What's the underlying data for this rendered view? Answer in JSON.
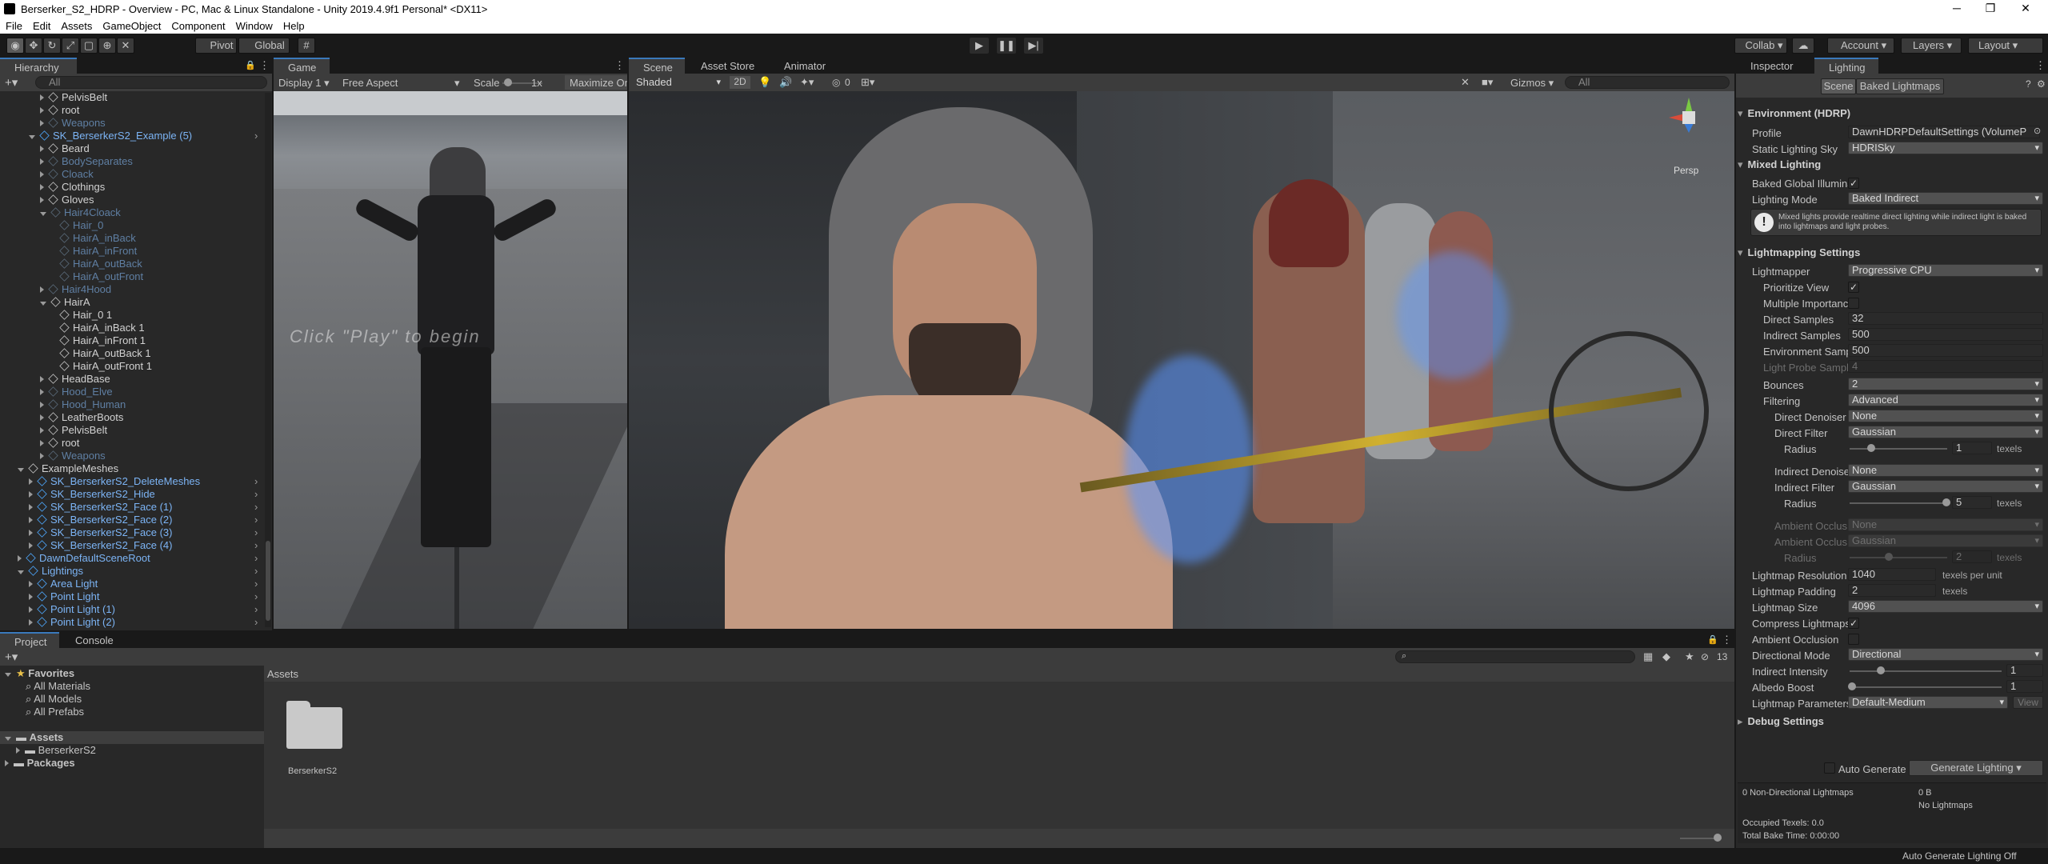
{
  "window": {
    "title": "Berserker_S2_HDRP - Overview - PC, Mac & Linux Standalone - Unity 2019.4.9f1 Personal* <DX11>"
  },
  "menu": [
    "File",
    "Edit",
    "Assets",
    "GameObject",
    "Component",
    "Window",
    "Help"
  ],
  "toolbar": {
    "pivot": "Pivot",
    "global": "Global",
    "collab": "Collab",
    "account": "Account",
    "layers": "Layers",
    "layout": "Layout"
  },
  "hierarchy": {
    "tab": "Hierarchy",
    "search_placeholder": "All",
    "items": [
      {
        "label": "PelvisBelt",
        "style": "white",
        "indent": 3
      },
      {
        "label": "root",
        "style": "white",
        "indent": 3
      },
      {
        "label": "Weapons",
        "style": "dim",
        "indent": 3
      },
      {
        "label": "SK_BerserkerS2_Example (5)",
        "style": "blue",
        "indent": 2,
        "expanded": true
      },
      {
        "label": "Beard",
        "style": "white",
        "indent": 3
      },
      {
        "label": "BodySeparates",
        "style": "dim",
        "indent": 3
      },
      {
        "label": "Cloack",
        "style": "dim",
        "indent": 3
      },
      {
        "label": "Clothings",
        "style": "white",
        "indent": 3
      },
      {
        "label": "Gloves",
        "style": "white",
        "indent": 3
      },
      {
        "label": "Hair4Cloack",
        "style": "dim",
        "indent": 3,
        "expanded": true
      },
      {
        "label": "Hair_0",
        "style": "dim",
        "indent": 4
      },
      {
        "label": "HairA_inBack",
        "style": "dim",
        "indent": 4
      },
      {
        "label": "HairA_inFront",
        "style": "dim",
        "indent": 4
      },
      {
        "label": "HairA_outBack",
        "style": "dim",
        "indent": 4
      },
      {
        "label": "HairA_outFront",
        "style": "dim",
        "indent": 4
      },
      {
        "label": "Hair4Hood",
        "style": "dim",
        "indent": 3
      },
      {
        "label": "HairA",
        "style": "white",
        "indent": 3,
        "expanded": true
      },
      {
        "label": "Hair_0 1",
        "style": "white",
        "indent": 4
      },
      {
        "label": "HairA_inBack 1",
        "style": "white",
        "indent": 4
      },
      {
        "label": "HairA_inFront 1",
        "style": "white",
        "indent": 4
      },
      {
        "label": "HairA_outBack 1",
        "style": "white",
        "indent": 4
      },
      {
        "label": "HairA_outFront 1",
        "style": "white",
        "indent": 4
      },
      {
        "label": "HeadBase",
        "style": "white",
        "indent": 3
      },
      {
        "label": "Hood_Elve",
        "style": "dim",
        "indent": 3
      },
      {
        "label": "Hood_Human",
        "style": "dim",
        "indent": 3
      },
      {
        "label": "LeatherBoots",
        "style": "white",
        "indent": 3
      },
      {
        "label": "PelvisBelt",
        "style": "white",
        "indent": 3
      },
      {
        "label": "root",
        "style": "white",
        "indent": 3
      },
      {
        "label": "Weapons",
        "style": "dim",
        "indent": 3
      },
      {
        "label": "ExampleMeshes",
        "style": "white",
        "indent": 1,
        "expanded": true
      },
      {
        "label": "SK_BerserkerS2_DeleteMeshes",
        "style": "blue",
        "indent": 2
      },
      {
        "label": "SK_BerserkerS2_Hide",
        "style": "blue",
        "indent": 2
      },
      {
        "label": "SK_BerserkerS2_Face (1)",
        "style": "blue",
        "indent": 2
      },
      {
        "label": "SK_BerserkerS2_Face (2)",
        "style": "blue",
        "indent": 2
      },
      {
        "label": "SK_BerserkerS2_Face (3)",
        "style": "blue",
        "indent": 2
      },
      {
        "label": "SK_BerserkerS2_Face (4)",
        "style": "blue",
        "indent": 2
      },
      {
        "label": "DawnDefaultSceneRoot",
        "style": "blue",
        "indent": 1
      },
      {
        "label": "Lightings",
        "style": "blue",
        "indent": 1,
        "expanded": true
      },
      {
        "label": "Area Light",
        "style": "blue",
        "indent": 2
      },
      {
        "label": "Point Light",
        "style": "blue",
        "indent": 2
      },
      {
        "label": "Point Light (1)",
        "style": "blue",
        "indent": 2
      },
      {
        "label": "Point Light (2)",
        "style": "blue",
        "indent": 2
      }
    ]
  },
  "game": {
    "tab": "Game",
    "display": "Display 1",
    "aspect": "Free Aspect",
    "scale_label": "Scale",
    "scale_value": "1x",
    "maximize": "Maximize On",
    "overlay_text": "Click \"Play\" to begin"
  },
  "scene": {
    "tabs": [
      "Scene",
      "Asset Store",
      "Animator"
    ],
    "shading": "Shaded",
    "mode2d": "2D",
    "fx_count": "0",
    "gizmos": "Gizmos",
    "search_placeholder": "All",
    "persp": "Persp"
  },
  "inspector": {
    "tabs": [
      "Inspector",
      "Lighting"
    ],
    "sub_tabs": [
      "Scene",
      "Baked Lightmaps"
    ],
    "environment": {
      "header": "Environment (HDRP)",
      "profile_label": "Profile",
      "profile_value": "DawnHDRPDefaultSettings (VolumeP",
      "sky_label": "Static Lighting Sky",
      "sky_value": "HDRISky"
    },
    "mixed": {
      "header": "Mixed Lighting",
      "baked_gi_label": "Baked Global Illumina",
      "mode_label": "Lighting Mode",
      "mode_value": "Baked Indirect",
      "help": "Mixed lights provide realtime direct lighting while indirect light is baked into lightmaps and light probes."
    },
    "lightmapping": {
      "header": "Lightmapping Settings",
      "lightmapper_label": "Lightmapper",
      "lightmapper_value": "Progressive CPU",
      "prioritize_label": "Prioritize View",
      "multiple_label": "Multiple Importanc",
      "direct_samples_label": "Direct Samples",
      "direct_samples_value": "32",
      "indirect_samples_label": "Indirect Samples",
      "indirect_samples_value": "500",
      "env_samples_label": "Environment Samp",
      "env_samples_value": "500",
      "probe_label": "Light Probe Sampl",
      "probe_value": "4",
      "bounces_label": "Bounces",
      "bounces_value": "2",
      "filtering_label": "Filtering",
      "filtering_value": "Advanced",
      "direct_denoiser_label": "Direct Denoiser",
      "direct_denoiser_value": "None",
      "direct_filter_label": "Direct Filter",
      "direct_filter_value": "Gaussian",
      "radius_label": "Radius",
      "direct_radius_value": "1",
      "texels": "texels",
      "indirect_denoiser_label": "Indirect Denoise",
      "indirect_denoiser_value": "None",
      "indirect_filter_label": "Indirect Filter",
      "indirect_filter_value": "Gaussian",
      "indirect_radius_value": "5",
      "ao1_label": "Ambient Occlus",
      "ao1_value": "None",
      "ao2_label": "Ambient Occlus",
      "ao2_value": "Gaussian",
      "ao_radius_value": "2",
      "resolution_label": "Lightmap Resolution",
      "resolution_value": "1040",
      "resolution_units": "texels per unit",
      "padding_label": "Lightmap Padding",
      "padding_value": "2",
      "size_label": "Lightmap Size",
      "size_value": "4096",
      "compress_label": "Compress Lightmaps",
      "ao_label": "Ambient Occlusion",
      "directional_label": "Directional Mode",
      "directional_value": "Directional",
      "indirect_intensity_label": "Indirect Intensity",
      "indirect_intensity_value": "1",
      "albedo_label": "Albedo Boost",
      "albedo_value": "1",
      "params_label": "Lightmap Parameters",
      "params_value": "Default-Medium",
      "view": "View"
    },
    "debug_header": "Debug Settings",
    "auto_generate": "Auto Generate",
    "generate": "Generate Lighting",
    "stats": {
      "nondir": "0 Non-Directional Lightmaps",
      "size": "0 B",
      "no_lightmaps": "No Lightmaps",
      "occupied": "Occupied Texels: 0.0",
      "bake_time": "Total Bake Time: 0:00:00"
    }
  },
  "project": {
    "tabs": [
      "Project",
      "Console"
    ],
    "favorites": "Favorites",
    "fav_items": [
      "All Materials",
      "All Models",
      "All Prefabs"
    ],
    "assets": "Assets",
    "asset_children": [
      "BerserkerS2"
    ],
    "packages": "Packages",
    "breadcrumb": "Assets",
    "folder_name": "BerserkerS2",
    "hidden_count": "13"
  },
  "status": {
    "text": "Auto Generate Lighting Off"
  },
  "colors": {
    "accent": "#3a79bb",
    "prefab_blue": "#7cb4f5",
    "panel": "#282828",
    "header": "#3c3c3c"
  }
}
